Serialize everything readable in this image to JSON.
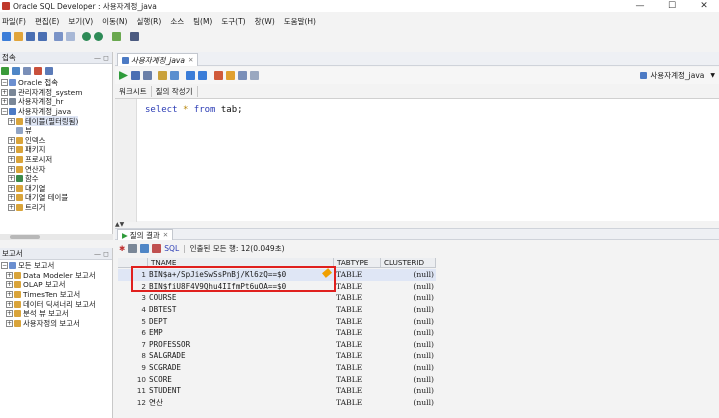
{
  "window": {
    "title": "Oracle SQL Developer : 사용자계정_java",
    "controls": [
      "—",
      "☐",
      "✕"
    ]
  },
  "menu": [
    "파일(F)",
    "편집(E)",
    "보기(V)",
    "이동(N)",
    "실행(R)",
    "소스",
    "팀(M)",
    "도구(T)",
    "창(W)",
    "도움말(H)"
  ],
  "connections_panel": {
    "title": "접속",
    "nodes": [
      {
        "label": "Oracle 접속",
        "level": 0,
        "expander": "−"
      },
      {
        "label": "관리자계정_system",
        "level": 1,
        "expander": "+"
      },
      {
        "label": "사용자계정_hr",
        "level": 1,
        "expander": "+"
      },
      {
        "label": "사용자계정_java",
        "level": 1,
        "expander": "−"
      },
      {
        "label": "테이블(필터링됨)",
        "level": 2,
        "expander": "+",
        "selected": true
      },
      {
        "label": "뷰",
        "level": 2,
        "expander": ""
      },
      {
        "label": "인덱스",
        "level": 2,
        "expander": "+"
      },
      {
        "label": "패키지",
        "level": 2,
        "expander": "+"
      },
      {
        "label": "프로시저",
        "level": 2,
        "expander": "+"
      },
      {
        "label": "연산자",
        "level": 2,
        "expander": "+"
      },
      {
        "label": "함수",
        "level": 2,
        "expander": "+"
      },
      {
        "label": "대기열",
        "level": 2,
        "expander": "+"
      },
      {
        "label": "대기열 테이블",
        "level": 2,
        "expander": "+"
      },
      {
        "label": "트리거",
        "level": 2,
        "expander": "+"
      }
    ]
  },
  "reports_panel": {
    "title": "보고서",
    "nodes": [
      {
        "label": "모든 보고서",
        "level": 0,
        "expander": "−"
      },
      {
        "label": "Data Modeler 보고서",
        "level": 1,
        "expander": "+"
      },
      {
        "label": "OLAP 보고서",
        "level": 1,
        "expander": "+"
      },
      {
        "label": "TimesTen 보고서",
        "level": 1,
        "expander": "+"
      },
      {
        "label": "데이터 딕셔너리 보고서",
        "level": 1,
        "expander": "+"
      },
      {
        "label": "분석 뷰 보고서",
        "level": 1,
        "expander": "+"
      },
      {
        "label": "사용자정의 보고서",
        "level": 1,
        "expander": "+"
      }
    ]
  },
  "editor": {
    "tab_label": "사용자계정_java",
    "connection": "사용자계정_java",
    "subtabs": [
      "워크시트",
      "질의 작성기"
    ],
    "code": {
      "kw1": "select",
      "star": "*",
      "kw2": "from",
      "rest": " tab;"
    }
  },
  "results": {
    "tab_label": "질의 결과",
    "sql_label": "SQL",
    "status": "인출된 모든 행: 12(0.049초)",
    "columns": [
      "TNAME",
      "TABTYPE",
      "CLUSTERID"
    ],
    "rows": [
      {
        "n": "1",
        "tname": "BIN$a+/SpJieSwSsPnBj/Kl6zQ==$0",
        "ttype": "TABLE",
        "clid": "(null)"
      },
      {
        "n": "2",
        "tname": "BIN$fiU8F4V9Qhu4IIfmPt6uOA==$0",
        "ttype": "TABLE",
        "clid": "(null)"
      },
      {
        "n": "3",
        "tname": "COURSE",
        "ttype": "TABLE",
        "clid": "(null)"
      },
      {
        "n": "4",
        "tname": "DBTEST",
        "ttype": "TABLE",
        "clid": "(null)"
      },
      {
        "n": "5",
        "tname": "DEPT",
        "ttype": "TABLE",
        "clid": "(null)"
      },
      {
        "n": "6",
        "tname": "EMP",
        "ttype": "TABLE",
        "clid": "(null)"
      },
      {
        "n": "7",
        "tname": "PROFESSOR",
        "ttype": "TABLE",
        "clid": "(null)"
      },
      {
        "n": "8",
        "tname": "SALGRADE",
        "ttype": "TABLE",
        "clid": "(null)"
      },
      {
        "n": "9",
        "tname": "SCGRADE",
        "ttype": "TABLE",
        "clid": "(null)"
      },
      {
        "n": "10",
        "tname": "SCORE",
        "ttype": "TABLE",
        "clid": "(null)"
      },
      {
        "n": "11",
        "tname": "STUDENT",
        "ttype": "TABLE",
        "clid": "(null)"
      },
      {
        "n": "12",
        "tname": "연산",
        "ttype": "TABLE",
        "clid": "(null)"
      }
    ]
  },
  "colors": {
    "highlight": "#e0201e",
    "keyword": "#2b3cb5",
    "selection": "#dfe6f5"
  }
}
